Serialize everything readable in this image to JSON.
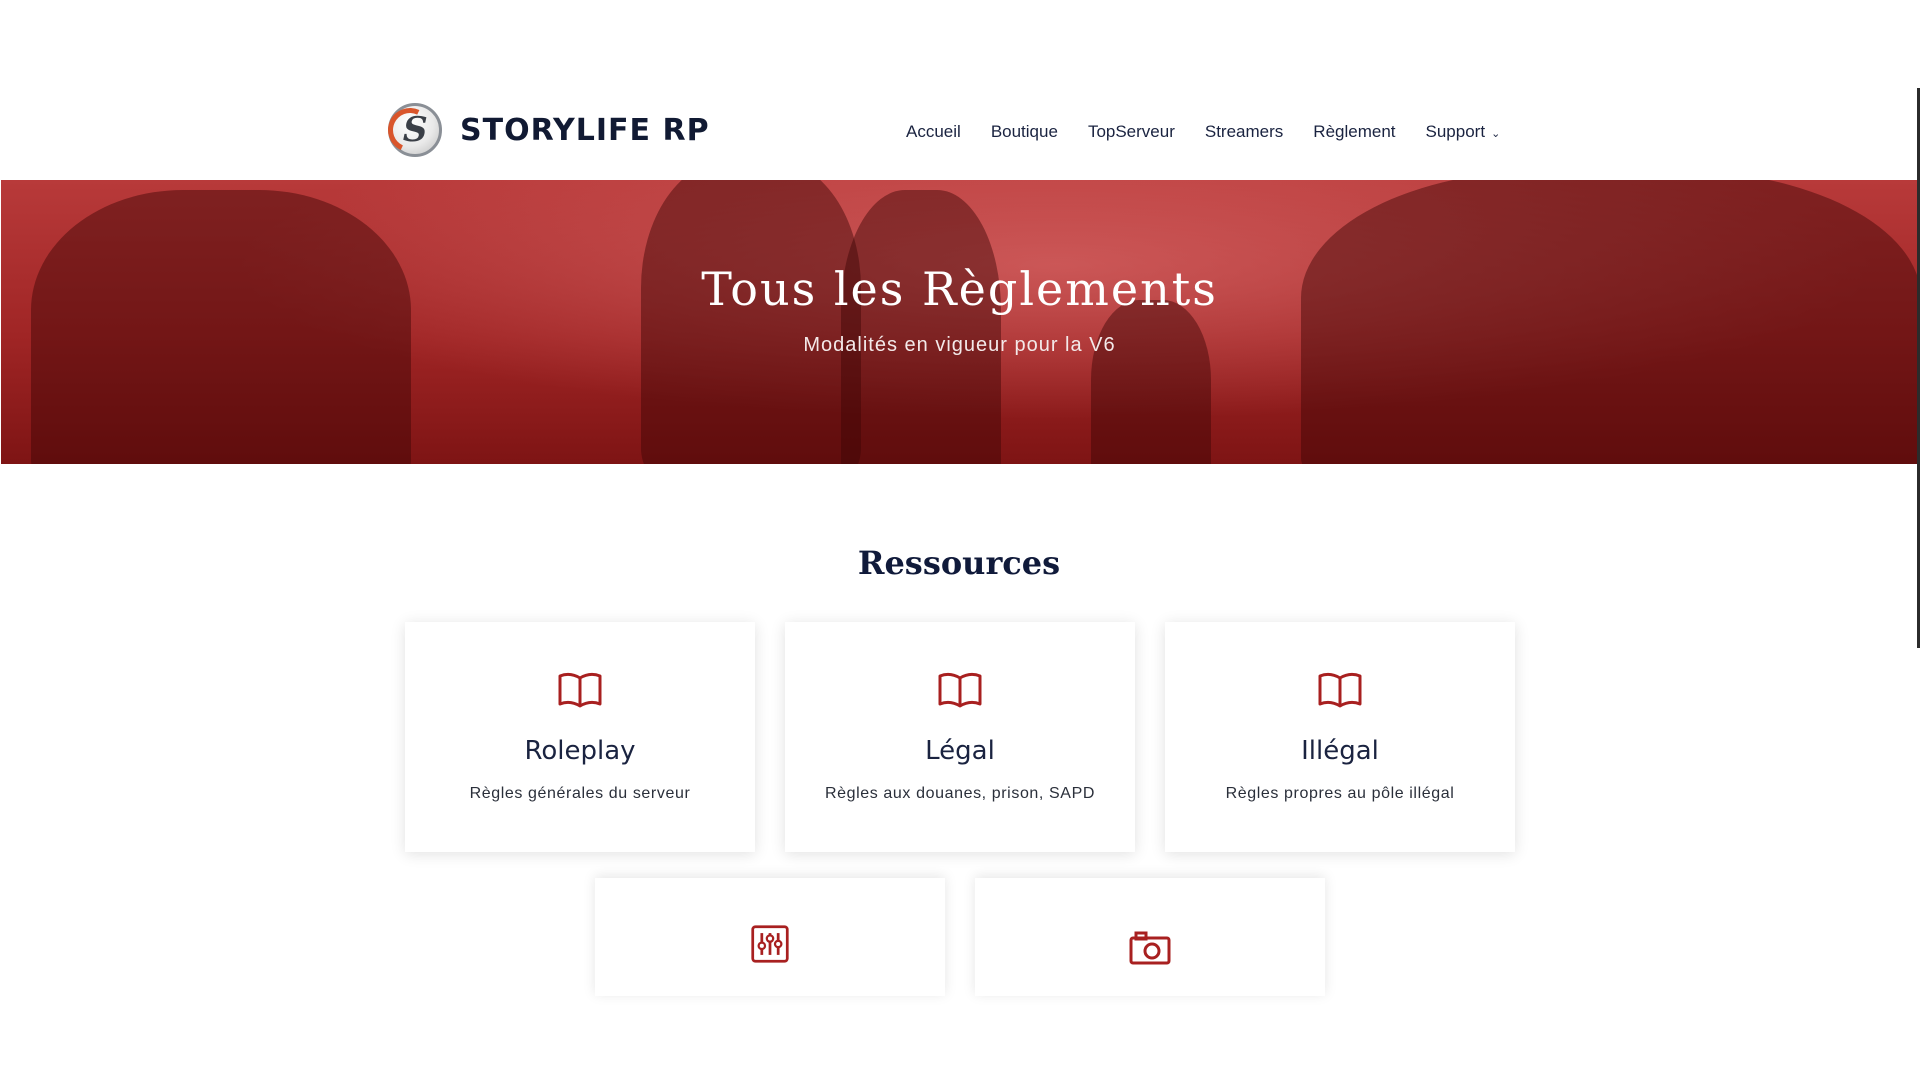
{
  "brand": {
    "name": "STORYLIFE RP",
    "logo_letter": "S",
    "accent_color": "#a82020"
  },
  "nav": {
    "items": [
      {
        "label": "Accueil"
      },
      {
        "label": "Boutique"
      },
      {
        "label": "TopServeur"
      },
      {
        "label": "Streamers"
      },
      {
        "label": "Règlement"
      },
      {
        "label": "Support",
        "has_dropdown": true
      }
    ],
    "dropdown_icon": "chevron-down-icon"
  },
  "hero": {
    "title": "Tous les Règlements",
    "subtitle": "Modalités en vigueur pour la V6"
  },
  "resources": {
    "title": "Ressources",
    "cards": [
      {
        "icon": "book-icon",
        "title": "Roleplay",
        "description": "Règles générales du serveur"
      },
      {
        "icon": "book-icon",
        "title": "Légal",
        "description": "Règles aux douanes, prison, SAPD"
      },
      {
        "icon": "book-icon",
        "title": "Illégal",
        "description": "Règles propres au pôle illégal"
      },
      {
        "icon": "sliders-icon",
        "title": "",
        "description": ""
      },
      {
        "icon": "camera-icon",
        "title": "",
        "description": ""
      }
    ]
  }
}
